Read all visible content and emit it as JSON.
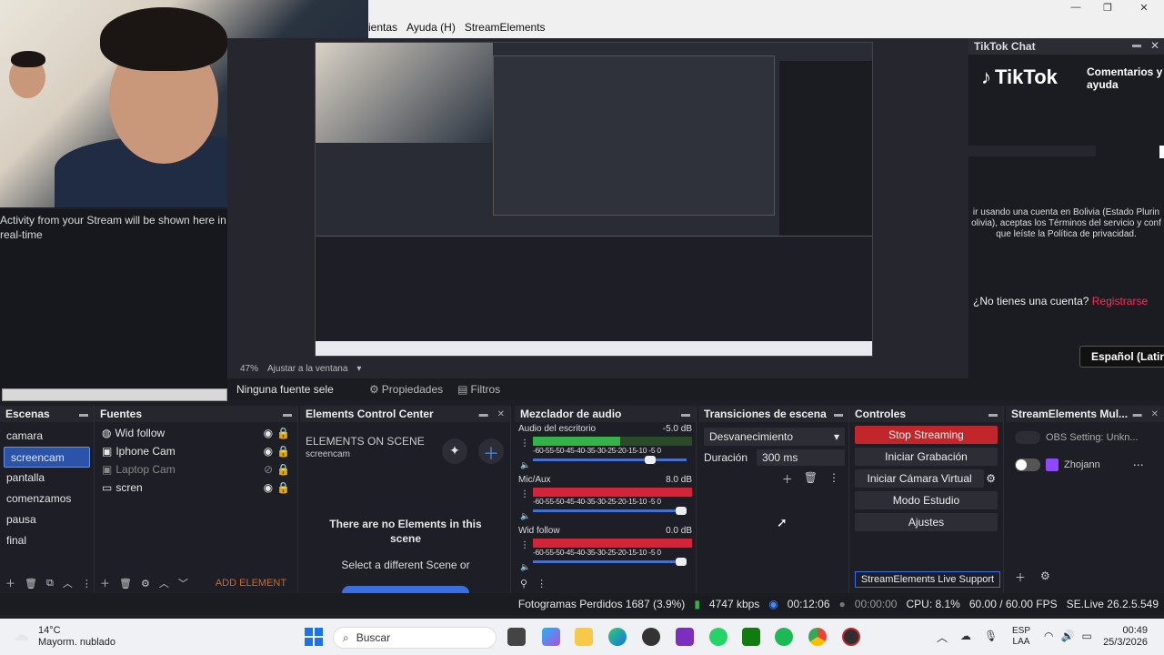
{
  "menu": {
    "items": [
      "ientas",
      "Ayuda (H)",
      "StreamElements"
    ]
  },
  "window_controls": [
    "—",
    "❐",
    "✕"
  ],
  "activity": {
    "text": "Activity from your Stream will be shown here in real-time"
  },
  "preview": {
    "zoom": "47%",
    "fit": "Ajustar a la ventana"
  },
  "propbar": {
    "source": "Ninguna fuente sele",
    "properties": "Propiedades",
    "filters": "Filtros"
  },
  "tiktok": {
    "title": "TikTok Chat",
    "logo": "TikTok",
    "help": "Comentarios y ayuda",
    "legal_1": "ir usando una cuenta en Bolivia (Estado Plurin",
    "legal_2": "olivia), aceptas los Términos del servicio y conf",
    "legal_3": "que leíste la Política de privacidad.",
    "account_q": "¿No tienes una cuenta?",
    "register": "Registrarse",
    "language": "Español (Latino"
  },
  "scenes": {
    "title": "Escenas",
    "items": [
      "camara",
      "screencam",
      "pantalla",
      "comenzamos",
      "pausa",
      "final"
    ],
    "selected": 1
  },
  "sources": {
    "title": "Fuentes",
    "items": [
      {
        "name": "Wid follow",
        "icon": "browser-icon",
        "visible": true
      },
      {
        "name": "Iphone Cam",
        "icon": "camera-icon",
        "visible": true
      },
      {
        "name": "Laptop Cam",
        "icon": "camera-icon",
        "visible": false
      },
      {
        "name": "scren",
        "icon": "monitor-icon",
        "visible": true
      }
    ],
    "add_element": "ADD ELEMENT"
  },
  "elements": {
    "title": "Elements Control Center",
    "on_scene": "ELEMENTS ON SCENE",
    "scene": "screencam",
    "empty_title": "There are no Elements in this scene",
    "empty_sub": "Select a different Scene or"
  },
  "mixer": {
    "title": "Mezclador de audio",
    "ticks": "-60-55-50-45-40-35-30-25-20-15-10 -5 0",
    "tracks": [
      {
        "name": "Audio del escritorio",
        "db": "-5.0 dB",
        "level": 0.55,
        "volume": 0.8
      },
      {
        "name": "Mic/Aux",
        "db": "8.0 dB",
        "level": 1.0,
        "volume": 1.0
      },
      {
        "name": "Wid follow",
        "db": "0.0 dB",
        "level": 1.0,
        "volume": 1.0
      }
    ]
  },
  "transitions": {
    "title": "Transiciones de escena",
    "type": "Desvanecimiento",
    "duration_label": "Duración",
    "duration": "300 ms"
  },
  "controls": {
    "title": "Controles",
    "stop": "Stop Streaming",
    "record": "Iniciar Grabación",
    "virtual_cam": "Iniciar Cámara Virtual",
    "studio": "Modo Estudio",
    "settings": "Ajustes",
    "support": "StreamElements Live Support"
  },
  "se": {
    "title": "StreamElements Mul...",
    "row1": "OBS Setting: Unkn...",
    "row2": "Zhojann"
  },
  "status": {
    "frames": "Fotogramas Perdidos 1687 (3.9%)",
    "bitrate": "4747 kbps",
    "stream_time": "00:12:06",
    "rec_time": "00:00:00",
    "cpu": "CPU: 8.1%",
    "fps": "60.00 / 60.00 FPS",
    "version": "SE.Live 26.2.5.549"
  },
  "taskbar": {
    "temp": "14°C",
    "weather": "Mayorm. nublado",
    "search": "Buscar",
    "lang1": "ESP",
    "lang2": "LAA",
    "time": "00:49",
    "date": "25/3/2026"
  },
  "colors": {
    "accent": "#2b53a8",
    "stop": "#c1262b",
    "tiktok_red": "#fe2c55",
    "meter_green": "#36b24a",
    "meter_red": "#d3253a"
  }
}
